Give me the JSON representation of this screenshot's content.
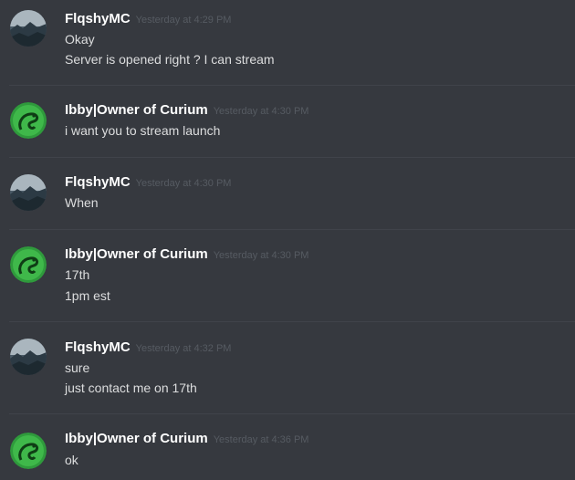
{
  "colors": {
    "background": "#36393f",
    "username": "#ffffff",
    "timestamp": "#565b62",
    "message_text": "#dcddde",
    "divider": "#40434a"
  },
  "messages": [
    {
      "author": "FlqshyMC",
      "avatar": "mountain-landscape-avatar",
      "timestamp": "Yesterday at 4:29 PM",
      "lines": [
        "Okay",
        "Server is opened right ? I can stream"
      ]
    },
    {
      "author": "Ibby|Owner of Curium",
      "avatar": "green-snake-avatar",
      "timestamp": "Yesterday at 4:30 PM",
      "lines": [
        "i want you to stream launch"
      ]
    },
    {
      "author": "FlqshyMC",
      "avatar": "mountain-landscape-avatar",
      "timestamp": "Yesterday at 4:30 PM",
      "lines": [
        "When"
      ]
    },
    {
      "author": "Ibby|Owner of Curium",
      "avatar": "green-snake-avatar",
      "timestamp": "Yesterday at 4:30 PM",
      "lines": [
        "17th",
        "1pm est"
      ]
    },
    {
      "author": "FlqshyMC",
      "avatar": "mountain-landscape-avatar",
      "timestamp": "Yesterday at 4:32 PM",
      "lines": [
        "sure",
        "just contact me on 17th"
      ]
    },
    {
      "author": "Ibby|Owner of Curium",
      "avatar": "green-snake-avatar",
      "timestamp": "Yesterday at 4:36 PM",
      "lines": [
        "ok"
      ]
    }
  ]
}
